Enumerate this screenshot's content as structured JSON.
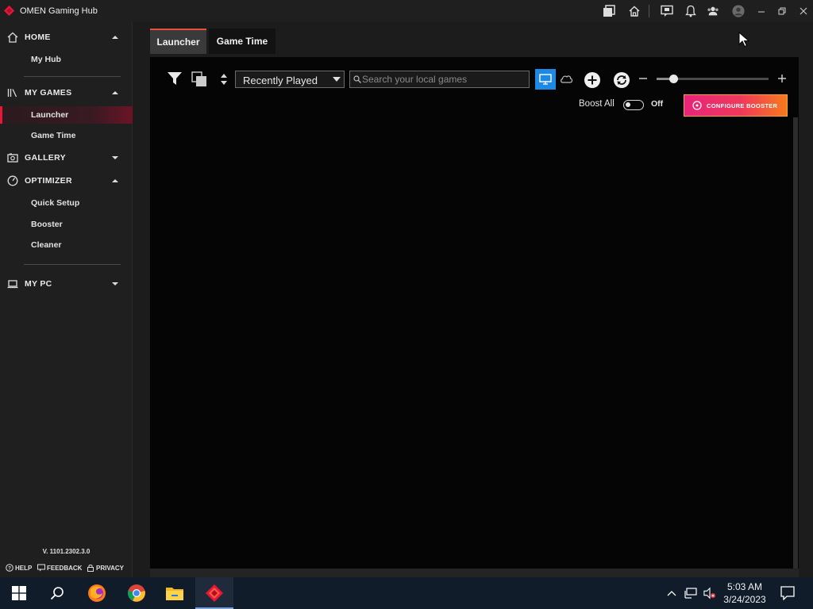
{
  "titlebar": {
    "app_title": "OMEN Gaming Hub"
  },
  "sidebar": {
    "sections": [
      {
        "label": "HOME",
        "expanded": true,
        "icon": "home-icon",
        "items": [
          {
            "label": "My Hub"
          }
        ]
      },
      {
        "label": "MY GAMES",
        "expanded": true,
        "icon": "library-icon",
        "items": [
          {
            "label": "Launcher",
            "active": true
          },
          {
            "label": "Game Time"
          }
        ]
      },
      {
        "label": "GALLERY",
        "expanded": false,
        "icon": "gallery-icon",
        "items": []
      },
      {
        "label": "OPTIMIZER",
        "expanded": true,
        "icon": "gauge-icon",
        "items": [
          {
            "label": "Quick Setup"
          },
          {
            "label": "Booster"
          },
          {
            "label": "Cleaner"
          }
        ]
      },
      {
        "label": "MY PC",
        "expanded": false,
        "icon": "laptop-icon",
        "items": []
      }
    ],
    "version": "V. 1101.2302.3.0",
    "footer": {
      "help": "HELP",
      "feedback": "FEEDBACK",
      "privacy": "PRIVACY"
    }
  },
  "main": {
    "tabs": [
      {
        "label": "Launcher",
        "active": true
      },
      {
        "label": "Game Time",
        "active": false
      }
    ],
    "toolbar": {
      "sort_selected": "Recently Played",
      "search_placeholder": "Search your local games",
      "view_local_selected": true,
      "zoom_level": 0.15,
      "boost_all_label": "Boost All",
      "boost_all_state": "Off",
      "configure_booster_label": "CONFIGURE BOOSTER"
    }
  },
  "taskbar": {
    "apps": [
      "windows-start",
      "search",
      "firefox",
      "chrome",
      "file-explorer",
      "omen-gaming-hub"
    ],
    "active_app": "omen-gaming-hub",
    "time": "5:03 AM",
    "date": "3/24/2023"
  },
  "colors": {
    "accent_red": "#e8173a",
    "config_gradient_start": "#e8247a",
    "config_gradient_end": "#f77a1c",
    "toggle_selected": "#1e88e5"
  }
}
